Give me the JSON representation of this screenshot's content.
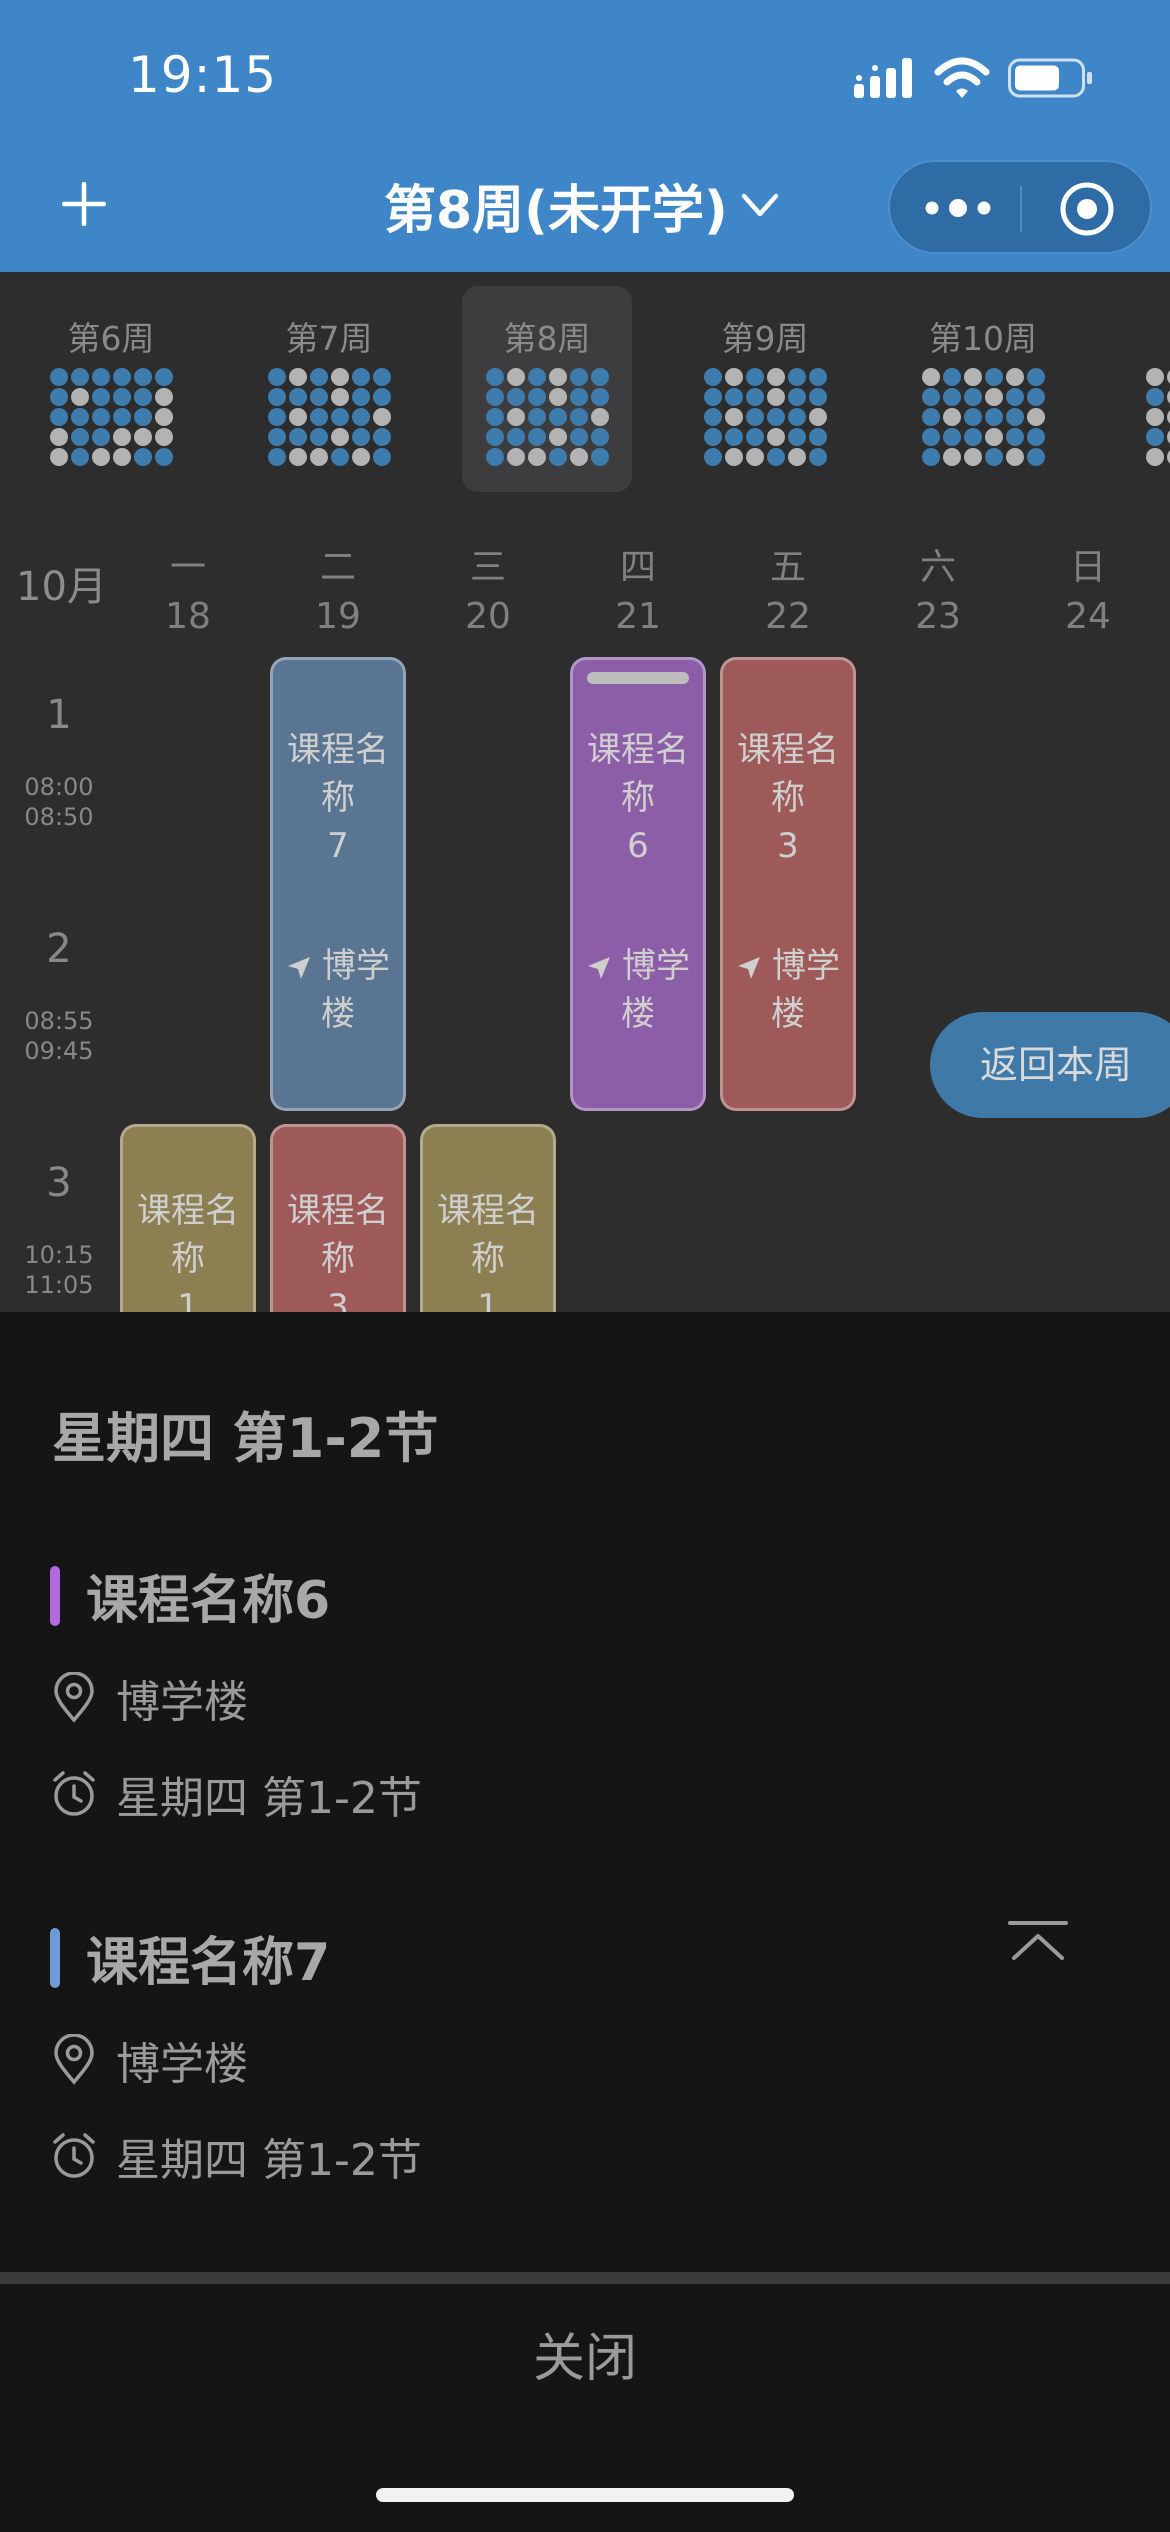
{
  "status_bar": {
    "time": "19:15"
  },
  "nav": {
    "title": "第8周(未开学)",
    "icons": [
      "plus-icon",
      "chevron-down-icon",
      "more-icon",
      "target-icon"
    ]
  },
  "colors": {
    "header": "#3f86c8",
    "blue_dot": "#3e7cae",
    "grey_dot": "#b3b3b3",
    "course_blue": "#5a7592",
    "course_purple": "#8d5ea8",
    "course_red": "#9e5959",
    "course_yellow": "#8c7f52",
    "bar_purple": "#b26ae0",
    "bar_blue": "#6f9bd6"
  },
  "week_selector": [
    {
      "label": "第6周",
      "active": false,
      "dots": "bbbbbbbgbbbgbbbbbggbbggggbggbbgggg"
    },
    {
      "label": "第7周",
      "active": false,
      "dots": "bgbgbbbbbgbbbgbbbgbbbgbbbggbgbbggg"
    },
    {
      "label": "第8周",
      "active": true,
      "dots": "bgbgbbbbbgbbbgbbbgbbbgbbbggbgbbggg"
    },
    {
      "label": "第9周",
      "active": false,
      "dots": "bgbgbbbbbgbbbgbbbgbbbgbbbggbgbbggg"
    },
    {
      "label": "第10周",
      "active": false,
      "dots": "gbgbgbbbbgbbbgbbbgbbbgbbbggbgbbggg"
    }
  ],
  "calendar": {
    "month": "10月",
    "days": [
      {
        "name": "一",
        "date": "18"
      },
      {
        "name": "二",
        "date": "19"
      },
      {
        "name": "三",
        "date": "20"
      },
      {
        "name": "四",
        "date": "21"
      },
      {
        "name": "五",
        "date": "22"
      },
      {
        "name": "六",
        "date": "23"
      },
      {
        "name": "日",
        "date": "24"
      }
    ],
    "periods": [
      {
        "num": "1",
        "start": "08:00",
        "end": "08:50"
      },
      {
        "num": "2",
        "start": "08:55",
        "end": "09:45"
      },
      {
        "num": "3",
        "start": "10:15",
        "end": "11:05"
      }
    ],
    "courses": [
      {
        "name": "课程名称7",
        "location": "博学楼",
        "day": "二",
        "periods": "1-2"
      },
      {
        "name": "课程名称6",
        "location": "博学楼",
        "day": "四",
        "periods": "1-2"
      },
      {
        "name": "课程名称3",
        "location": "博学楼",
        "day": "五",
        "periods": "1-2"
      },
      {
        "name": "课程名称1",
        "day": "一",
        "periods": "3"
      },
      {
        "name": "课程名称3",
        "day": "二",
        "periods": "3"
      },
      {
        "name": "课程名称1",
        "day": "三",
        "periods": "3"
      }
    ],
    "back_button": "返回本周"
  },
  "sheet": {
    "title": "星期四 第1-2节",
    "entries": [
      {
        "name": "课程名称6",
        "location": "博学楼",
        "time": "星期四 第1-2节"
      },
      {
        "name": "课程名称7",
        "location": "博学楼",
        "time": "星期四 第1-2节"
      }
    ],
    "close": "关闭"
  }
}
